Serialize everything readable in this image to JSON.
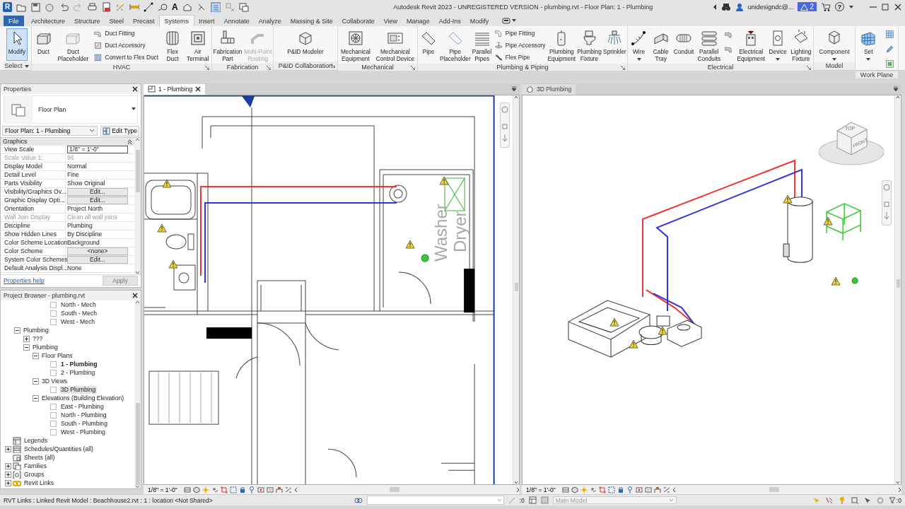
{
  "title_bar": {
    "logo": "R",
    "text_tool": "A",
    "title": "Autodesk Revit 2023 - UNREGISTERED VERSION - plumbing.rvt - Floor Plan: 1 - Plumbing",
    "user": "unidesigndc@...",
    "alerts": "2",
    "help": "?"
  },
  "ribbon_tabs": [
    {
      "label": "File",
      "kind": "file",
      "selected": false
    },
    {
      "label": "Architecture",
      "kind": "tab",
      "selected": false
    },
    {
      "label": "Structure",
      "kind": "tab",
      "selected": false
    },
    {
      "label": "Steel",
      "kind": "tab",
      "selected": false
    },
    {
      "label": "Precast",
      "kind": "tab",
      "selected": false
    },
    {
      "label": "Systems",
      "kind": "tab",
      "selected": true
    },
    {
      "label": "Insert",
      "kind": "tab",
      "selected": false
    },
    {
      "label": "Annotate",
      "kind": "tab",
      "selected": false
    },
    {
      "label": "Analyze",
      "kind": "tab",
      "selected": false
    },
    {
      "label": "Massing & Site",
      "kind": "tab",
      "selected": false
    },
    {
      "label": "Collaborate",
      "kind": "tab",
      "selected": false
    },
    {
      "label": "View",
      "kind": "tab",
      "selected": false
    },
    {
      "label": "Manage",
      "kind": "tab",
      "selected": false
    },
    {
      "label": "Add-Ins",
      "kind": "tab",
      "selected": false
    },
    {
      "label": "Modify",
      "kind": "tab",
      "selected": false
    }
  ],
  "ribbon_panels": [
    {
      "label": "Select",
      "dropdown": true,
      "launcher": false,
      "tools": [
        {
          "kind": "large",
          "lines": [
            "Modify"
          ],
          "selected": true,
          "disabled": false
        }
      ]
    },
    {
      "label": "HVAC",
      "launcher": true,
      "tools": [
        {
          "kind": "large",
          "lines": [
            "Duct"
          ],
          "selected": false,
          "disabled": false
        },
        {
          "kind": "large",
          "lines": [
            "Duct",
            "Placeholder"
          ],
          "selected": false,
          "disabled": false
        },
        {
          "kind": "small",
          "lines": [
            "Duct Fitting"
          ],
          "selected": false,
          "disabled": false
        },
        {
          "kind": "small",
          "lines": [
            "Duct Accessory"
          ],
          "selected": false,
          "disabled": false
        },
        {
          "kind": "small",
          "lines": [
            "Convert to Flex Duct"
          ],
          "selected": false,
          "disabled": false
        },
        {
          "kind": "large",
          "lines": [
            "Flex",
            "Duct"
          ],
          "selected": false,
          "disabled": false
        },
        {
          "kind": "large",
          "lines": [
            "Air",
            "Terminal"
          ],
          "selected": false,
          "disabled": false
        }
      ]
    },
    {
      "label": "Fabrication",
      "launcher": true,
      "tools": [
        {
          "kind": "large",
          "lines": [
            "Fabrication",
            "Part"
          ],
          "selected": false,
          "disabled": false
        },
        {
          "kind": "large",
          "lines": [
            "Multi-Point",
            "Routing"
          ],
          "selected": false,
          "disabled": true
        }
      ]
    },
    {
      "label": "P&ID Collaboration",
      "launcher": true,
      "tools": [
        {
          "kind": "large",
          "lines": [
            "P&ID Modeler"
          ],
          "selected": false,
          "disabled": false
        }
      ]
    },
    {
      "label": "Mechanical",
      "launcher": true,
      "tools": [
        {
          "kind": "large",
          "lines": [
            "Mechanical",
            "Equipment"
          ],
          "selected": false,
          "disabled": false
        },
        {
          "kind": "large",
          "lines": [
            "Mechanical",
            "Control Device"
          ],
          "selected": false,
          "disabled": false
        }
      ]
    },
    {
      "label": "Plumbing & Piping",
      "launcher": true,
      "tools": [
        {
          "kind": "large",
          "lines": [
            "Pipe"
          ],
          "selected": false,
          "disabled": false
        },
        {
          "kind": "large",
          "lines": [
            "Pipe",
            "Placeholder"
          ],
          "selected": false,
          "disabled": false
        },
        {
          "kind": "large",
          "lines": [
            "Parallel",
            "Pipes"
          ],
          "selected": false,
          "disabled": false
        },
        {
          "kind": "small",
          "lines": [
            "Pipe Fitting"
          ],
          "selected": false,
          "disabled": false
        },
        {
          "kind": "small",
          "lines": [
            "Pipe Accessory"
          ],
          "selected": false,
          "disabled": false
        },
        {
          "kind": "small",
          "lines": [
            "Flex Pipe"
          ],
          "selected": false,
          "disabled": false
        },
        {
          "kind": "large",
          "lines": [
            "Plumbing",
            "Equipment"
          ],
          "selected": false,
          "disabled": false
        },
        {
          "kind": "large",
          "lines": [
            "Plumbing",
            "Fixture"
          ],
          "selected": false,
          "disabled": false
        },
        {
          "kind": "large",
          "lines": [
            "Sprinkler"
          ],
          "selected": false,
          "disabled": false
        }
      ]
    },
    {
      "label": "Electrical",
      "launcher": true,
      "tools": [
        {
          "kind": "large",
          "lines": [
            "Wire"
          ],
          "dropdown": true,
          "selected": false,
          "disabled": false
        },
        {
          "kind": "large",
          "lines": [
            "Cable",
            "Tray"
          ],
          "selected": false,
          "disabled": false
        },
        {
          "kind": "large",
          "lines": [
            "Conduit"
          ],
          "selected": false,
          "disabled": false
        },
        {
          "kind": "large",
          "lines": [
            "Parallel",
            "Conduits"
          ],
          "selected": false,
          "disabled": false
        },
        {
          "kind": "icon",
          "selected": false,
          "disabled": false
        },
        {
          "kind": "icon",
          "selected": false,
          "disabled": false
        },
        {
          "kind": "large",
          "lines": [
            "Electrical",
            "Equipment"
          ],
          "selected": false,
          "disabled": false
        },
        {
          "kind": "large",
          "lines": [
            "Device"
          ],
          "dropdown": true,
          "selected": false,
          "disabled": false
        },
        {
          "kind": "large",
          "lines": [
            "Lighting",
            "Fixture"
          ],
          "selected": false,
          "disabled": false
        }
      ]
    },
    {
      "label": "Model",
      "launcher": false,
      "tools": [
        {
          "kind": "large",
          "lines": [
            "Component"
          ],
          "dropdown": true,
          "selected": false,
          "disabled": false
        }
      ]
    },
    {
      "label": "Work Plane",
      "launcher": false,
      "tools": [
        {
          "kind": "large",
          "lines": [
            "Set"
          ],
          "dropdown": true,
          "selected": false,
          "disabled": false
        },
        {
          "kind": "icon",
          "selected": false,
          "disabled": false
        },
        {
          "kind": "icon",
          "selected": false,
          "disabled": false
        },
        {
          "kind": "icon",
          "selected": false,
          "disabled": false
        }
      ]
    }
  ],
  "properties": {
    "title": "Properties",
    "type_name": "Floor Plan",
    "selector": "Floor Plan: 1 - Plumbing",
    "edit_type": "Edit Type",
    "section": "Graphics",
    "help": "Properties help",
    "apply": "Apply",
    "apply_disabled": true,
    "rows": [
      {
        "name": "View Scale",
        "value": "1/8\" = 1'-0\"",
        "kind": "field",
        "disabled": false
      },
      {
        "name": "Scale Value    1:",
        "value": "96",
        "kind": "text",
        "disabled": true
      },
      {
        "name": "Display Model",
        "value": "Normal",
        "kind": "text",
        "disabled": false
      },
      {
        "name": "Detail Level",
        "value": "Fine",
        "kind": "text",
        "disabled": false
      },
      {
        "name": "Parts Visibility",
        "value": "Show Original",
        "kind": "text",
        "disabled": false
      },
      {
        "name": "Visibility/Graphics Ov...",
        "value": "Edit...",
        "kind": "button",
        "disabled": false
      },
      {
        "name": "Graphic Display Opti...",
        "value": "Edit...",
        "kind": "button",
        "disabled": false
      },
      {
        "name": "Orientation",
        "value": "Project North",
        "kind": "text",
        "disabled": false
      },
      {
        "name": "Wall Join Display",
        "value": "Clean all wall joins",
        "kind": "text",
        "disabled": true
      },
      {
        "name": "Discipline",
        "value": "Plumbing",
        "kind": "text",
        "disabled": false
      },
      {
        "name": "Show Hidden Lines",
        "value": "By Discipline",
        "kind": "text",
        "disabled": false
      },
      {
        "name": "Color Scheme Location",
        "value": "Background",
        "kind": "text",
        "disabled": false
      },
      {
        "name": "Color Scheme",
        "value": "<none>",
        "kind": "button",
        "disabled": false
      },
      {
        "name": "System Color Schemes",
        "value": "Edit...",
        "kind": "button",
        "disabled": false
      },
      {
        "name": "Default Analysis Displ...",
        "value": "None",
        "kind": "text",
        "disabled": false
      }
    ]
  },
  "browser": {
    "title": "Project Browser - plumbing.rvt",
    "tree": [
      {
        "children": [
          {
            "children": [
              {
                "children": [
                  {
                    "children": [
                      {
                        "label": "North - Mech",
                        "kind": "view",
                        "selected": false,
                        "current": false
                      },
                      {
                        "label": "South - Mech",
                        "kind": "view",
                        "selected": false,
                        "current": false
                      },
                      {
                        "label": "West - Mech",
                        "kind": "view",
                        "selected": false,
                        "current": false
                      }
                    ]
                  }
                ]
              }
            ]
          },
          {
            "label": "Plumbing",
            "expanded": true,
            "selected": false,
            "children": [
              {
                "label": "???",
                "expanded": false,
                "selected": false
              },
              {
                "label": "Plumbing",
                "expanded": true,
                "selected": false,
                "children": [
                  {
                    "label": "Floor Plans",
                    "expanded": true,
                    "selected": false,
                    "children": [
                      {
                        "label": "1 - Plumbing",
                        "kind": "view",
                        "selected": false,
                        "current": true
                      },
                      {
                        "label": "2 - Plumbing",
                        "kind": "view",
                        "selected": false,
                        "current": false
                      }
                    ]
                  },
                  {
                    "label": "3D Views",
                    "expanded": true,
                    "selected": false,
                    "children": [
                      {
                        "label": "3D Plumbing",
                        "kind": "view",
                        "selected": true,
                        "current": false
                      }
                    ]
                  },
                  {
                    "label": "Elevations (Building Elevation)",
                    "expanded": true,
                    "selected": false,
                    "children": [
                      {
                        "label": "East - Plumbing",
                        "kind": "view",
                        "selected": false,
                        "current": false
                      },
                      {
                        "label": "North - Plumbing",
                        "kind": "view",
                        "selected": false,
                        "current": false
                      },
                      {
                        "label": "South - Plumbing",
                        "kind": "view",
                        "selected": false,
                        "current": false
                      },
                      {
                        "label": "West - Plumbing",
                        "kind": "view",
                        "selected": false,
                        "current": false
                      }
                    ]
                  }
                ]
              }
            ]
          }
        ]
      },
      {
        "label": "Legends",
        "kind": "legend",
        "selected": false
      },
      {
        "label": "Schedules/Quantities (all)",
        "kind": "schedule",
        "expanded": false,
        "selected": false
      },
      {
        "label": "Sheets (all)",
        "kind": "sheet",
        "selected": false
      },
      {
        "label": "Families",
        "kind": "family",
        "expanded": false,
        "selected": false
      },
      {
        "label": "Groups",
        "kind": "group",
        "expanded": false,
        "selected": false
      },
      {
        "label": "Revit Links",
        "kind": "link",
        "expanded": false,
        "selected": false
      }
    ]
  },
  "views": [
    {
      "kind": "plan",
      "tab": "1 - Plumbing",
      "active": true,
      "closable": true,
      "scale": "1/8\" = 1'-0\"",
      "labels": [
        "Washer",
        "Dryer"
      ]
    },
    {
      "kind": "model",
      "tab": "3D Plumbing",
      "active": false,
      "closable": false,
      "scale": "1/8\" = 1'-0\"",
      "labels": [
        "TOP",
        "FRONT"
      ]
    }
  ],
  "status_bar": {
    "text": "RVT Links : Linked Revit Model : Beachhouse2.rvt : 1 : location <Not Shared>",
    "count": ":0",
    "model": "Main Model",
    "filter": ":0"
  }
}
